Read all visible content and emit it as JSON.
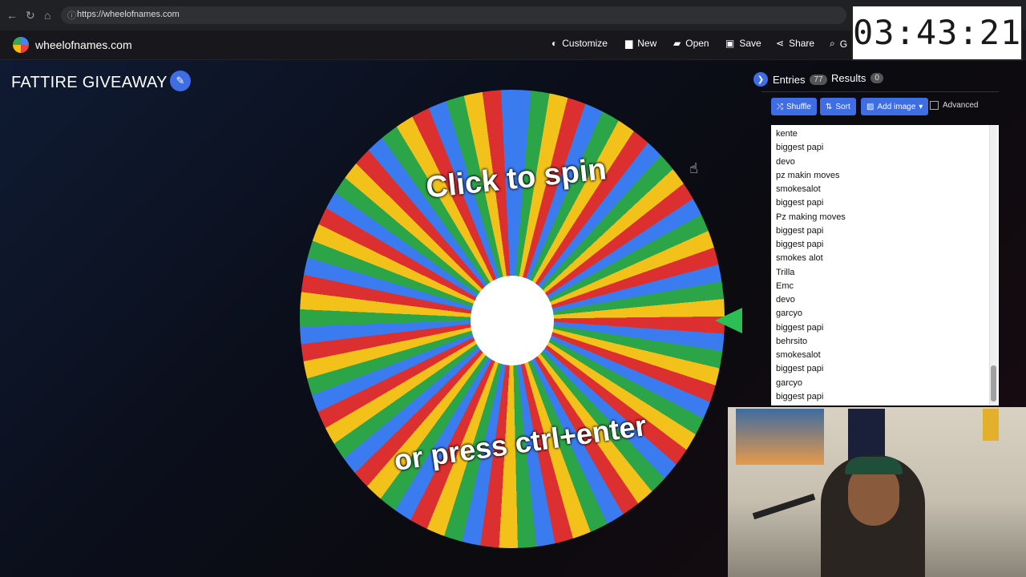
{
  "browser": {
    "url": "https://wheelofnames.com"
  },
  "header": {
    "site_name": "wheelofnames.com",
    "menu": [
      {
        "label": "Customize",
        "icon": "palette-icon"
      },
      {
        "label": "New",
        "icon": "file-icon"
      },
      {
        "label": "Open",
        "icon": "folder-icon"
      },
      {
        "label": "Save",
        "icon": "save-icon"
      },
      {
        "label": "Share",
        "icon": "share-icon"
      },
      {
        "label": "G",
        "icon": "search-icon"
      }
    ]
  },
  "page": {
    "title": "FATTIRE GIVEAWAY"
  },
  "wheel": {
    "prompt_top": "Click to spin",
    "prompt_bottom": "or press ctrl+enter",
    "colors": [
      "#3a7bf0",
      "#2ca548",
      "#f2c21a",
      "#dc2f2f"
    ]
  },
  "sidebar": {
    "tabs": [
      {
        "label": "Entries",
        "count": "77"
      },
      {
        "label": "Results",
        "count": "0"
      }
    ],
    "buttons": {
      "shuffle": "Shuffle",
      "sort": "Sort",
      "add_image": "Add image",
      "advanced": "Advanced"
    },
    "entries": [
      "kente",
      "biggest papi",
      "devo",
      "pz makin moves",
      "smokesalot",
      "biggest papi",
      "Pz making moves",
      "biggest papi",
      "biggest papi",
      "smokes alot",
      "Trilla",
      "Emc",
      "devo",
      "garcyo",
      "biggest papi",
      "behrsito",
      "smokesalot",
      "biggest papi",
      "garcyo",
      "biggest papi"
    ]
  },
  "timer": {
    "display": "03:43:21"
  }
}
